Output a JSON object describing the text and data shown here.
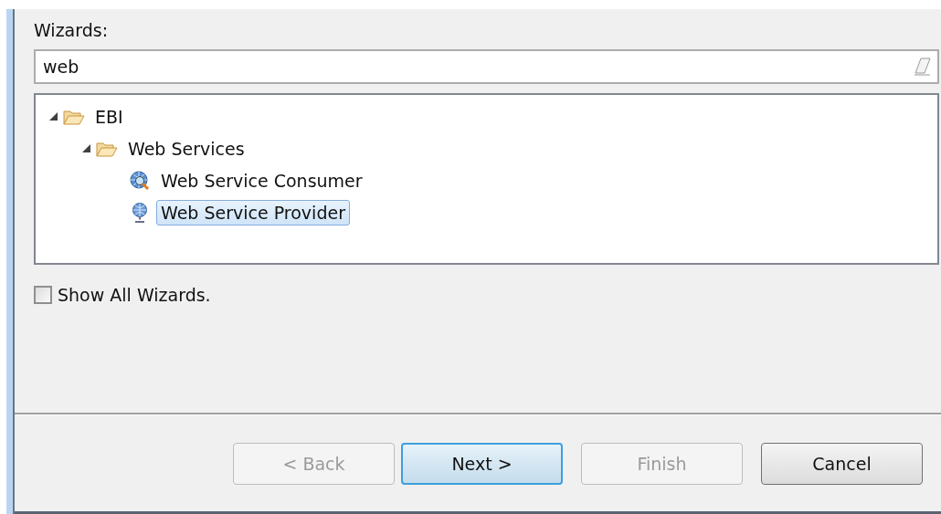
{
  "wizards_label": "Wizards:",
  "filter": {
    "value": "web"
  },
  "tree": [
    {
      "label": "EBI",
      "kind": "folder",
      "expanded": true,
      "selected": false,
      "children": [
        {
          "label": "Web Services",
          "kind": "folder",
          "expanded": true,
          "selected": false,
          "children": [
            {
              "label": "Web Service Consumer",
              "kind": "consumer",
              "selected": false
            },
            {
              "label": "Web Service Provider",
              "kind": "provider",
              "selected": true
            }
          ]
        }
      ]
    }
  ],
  "show_all": {
    "label": "Show All Wizards.",
    "checked": false
  },
  "buttons": [
    {
      "label": "< Back",
      "disabled": true,
      "default": false
    },
    {
      "label": "Next >",
      "disabled": false,
      "default": true
    },
    {
      "label": "Finish",
      "disabled": true,
      "default": false
    },
    {
      "label": "Cancel",
      "disabled": false,
      "default": false
    }
  ]
}
